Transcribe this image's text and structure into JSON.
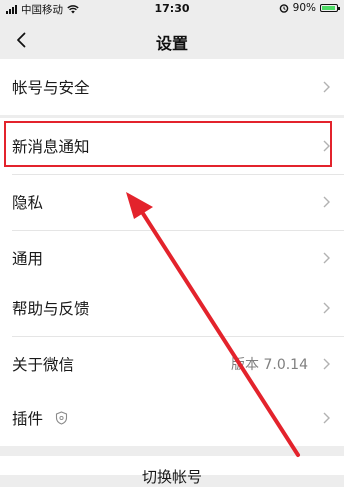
{
  "status_bar": {
    "carrier": "中国移动",
    "time": "17:30",
    "battery": "90%",
    "battery_level": 0.9
  },
  "nav": {
    "title": "设置"
  },
  "sections": {
    "account": {
      "label": "帐号与安全"
    },
    "notify": {
      "label": "新消息通知"
    },
    "privacy": {
      "label": "隐私"
    },
    "general": {
      "label": "通用"
    },
    "help": {
      "label": "帮助与反馈"
    },
    "about": {
      "label": "关于微信",
      "value": "版本 7.0.14"
    },
    "plugins": {
      "label": "插件"
    }
  },
  "bottom": {
    "label": "切换帐号"
  },
  "annotation": {
    "highlight_color": "#e3232c",
    "arrow_color": "#e3232c"
  },
  "icons": [
    "back-icon",
    "chevron-right-icon",
    "shield-icon",
    "wifi-icon",
    "alarm-icon",
    "battery-icon"
  ]
}
